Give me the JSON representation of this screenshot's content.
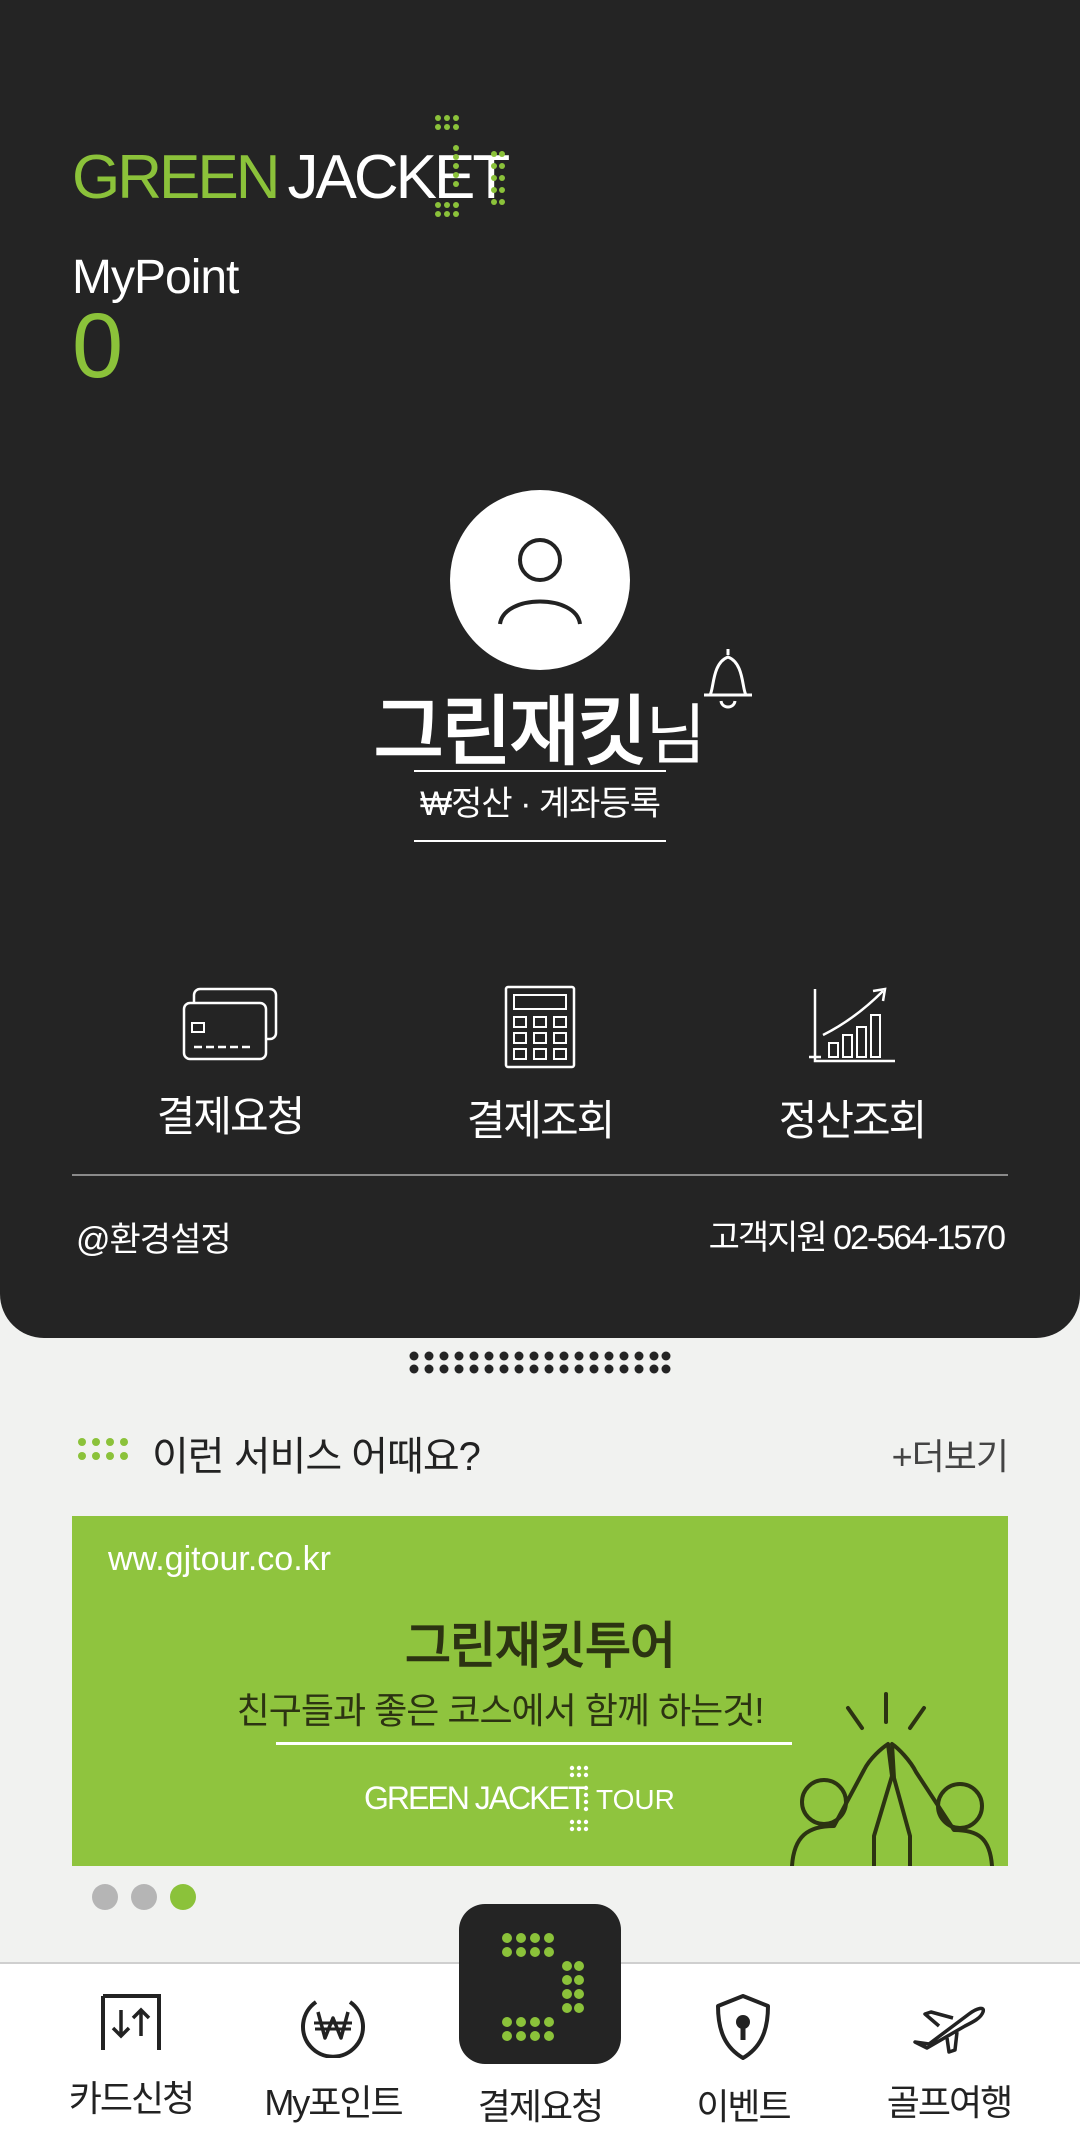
{
  "brand": {
    "logo_word1": "GREEN",
    "logo_word2": "JACKET",
    "accent": "#8bc23a",
    "dark": "#242424"
  },
  "points": {
    "label": "MyPoint",
    "value": "0"
  },
  "profile": {
    "name": "그린재킷",
    "suffix": "님",
    "avatar_icon": "user-icon",
    "notify_icon": "bell-icon"
  },
  "settlement_link": "₩정산 · 계좌등록",
  "quick_menu": [
    {
      "label": "결제요청",
      "icon": "card-icon"
    },
    {
      "label": "결제조회",
      "icon": "calculator-icon"
    },
    {
      "label": "정산조회",
      "icon": "chart-icon"
    }
  ],
  "footer": {
    "settings": "@환경설정",
    "support": "고객지원 02-564-1570"
  },
  "section": {
    "title": "이런 서비스 어때요?",
    "more": "+더보기"
  },
  "banner": {
    "url": "ww.gjtour.co.kr",
    "title": "그린재킷투어",
    "subtitle": "친구들과 좋은 코스에서 함께 하는것!",
    "logo_green": "GREEN",
    "logo_jacket": "JACKET",
    "logo_tour": "TOUR"
  },
  "pager": {
    "count": 3,
    "active_index": 2
  },
  "tabs": [
    {
      "label": "카드신청",
      "icon": "card-request-icon"
    },
    {
      "label": "My포인트",
      "icon": "won-coin-icon"
    },
    {
      "label": "결제요청",
      "icon": "payment-request-icon"
    },
    {
      "label": "이벤트",
      "icon": "shield-lock-icon"
    },
    {
      "label": "골프여행",
      "icon": "airplane-icon"
    }
  ]
}
